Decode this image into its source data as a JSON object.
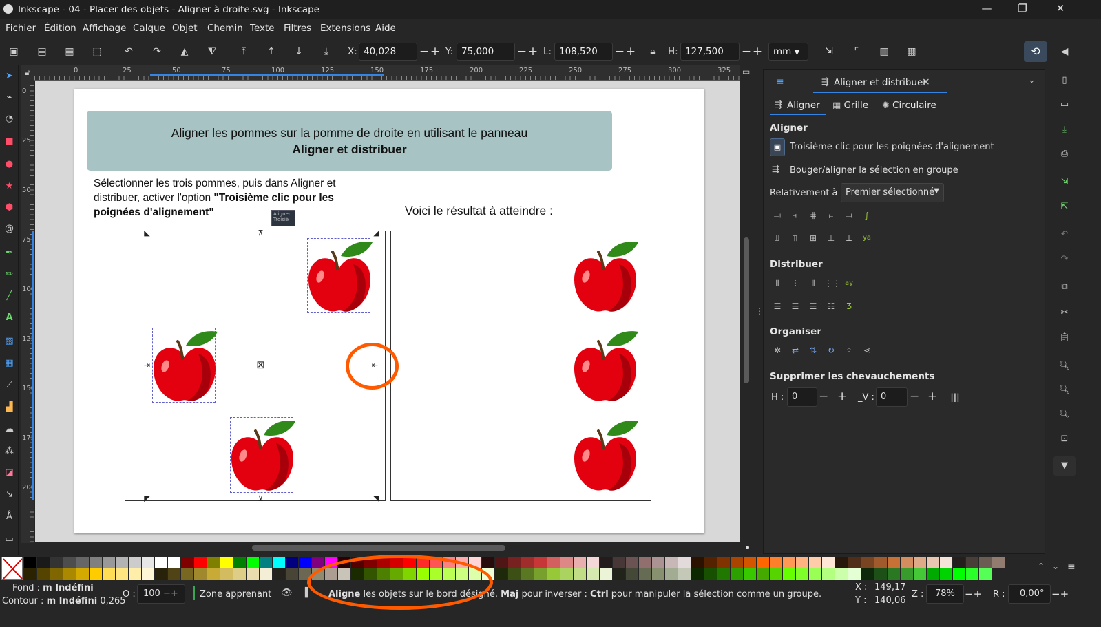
{
  "window": {
    "title": "Inkscape - 04 - Placer des objets - Aligner à droite.svg - Inkscape"
  },
  "menu": [
    "Fichier",
    "Édition",
    "Affichage",
    "Calque",
    "Objet",
    "Chemin",
    "Texte",
    "Filtres",
    "Extensions",
    "Aide"
  ],
  "toolbar": {
    "x_label": "X:",
    "x_value": "40,028",
    "y_label": "Y:",
    "y_value": "75,000",
    "w_label": "L:",
    "w_value": "108,520",
    "h_label": "H:",
    "h_value": "127,500",
    "unit": "mm",
    "minus": "−",
    "plus": "+"
  },
  "ruler": {
    "h_ticks": [
      "0",
      "25",
      "50",
      "75",
      "100",
      "125",
      "150",
      "175",
      "200",
      "225",
      "250",
      "275",
      "300",
      "325"
    ],
    "v_ticks": [
      "0",
      "25",
      "50",
      "75",
      "100",
      "125",
      "150",
      "175",
      "200"
    ]
  },
  "document": {
    "banner_line1": "Aligner les pommes sur la pomme de droite en utilisant le panneau",
    "banner_line2": "Aligner et distribuer",
    "instr_part1": "Sélectionner les trois pommes, puis dans Aligner et distribuer, activer l'option ",
    "instr_bold": "\"Troisième clic pour les poignées d'alignement\"",
    "tooltip_title": "Aligner",
    "tooltip_text": "Troisiè",
    "result_label": "Voici le résultat à atteindre :"
  },
  "panel": {
    "tab_label": "Aligner et distribuer",
    "tab_close": "×",
    "subtabs": [
      "Aligner",
      "Grille",
      "Circulaire"
    ],
    "align_title": "Aligner",
    "opt_third_click": "Troisième clic pour les poignées d'alignement",
    "opt_move_group": "Bouger/aligner la sélection en groupe",
    "relative_label": "Relativement à :",
    "relative_value": "Premier sélectionné",
    "distribute_title": "Distribuer",
    "organize_title": "Organiser",
    "overlap_title": "Supprimer les chevauchements",
    "h_label": "H :",
    "h_value": "0",
    "v_label": "_V :",
    "v_value": "0",
    "minus": "−",
    "plus": "+"
  },
  "status": {
    "fill_label": "Fond :",
    "fill_value": "m Indéfini",
    "stroke_label": "Contour :",
    "stroke_value": "m Indéfini",
    "stroke_width": "0,265",
    "opacity_label": "O :",
    "opacity_value": "100",
    "layer": "Zone apprenant",
    "msg_bold1": "Aligne",
    "msg_1": " les objets sur le bord désigné. ",
    "msg_bold2": "Maj",
    "msg_2": " pour inverser : ",
    "msg_bold3": "Ctrl",
    "msg_3": " pour manipuler la sélection comme un groupe.",
    "x_label": "X :",
    "x_value": "149,17",
    "y_label": "Y :",
    "y_value": "140,06",
    "zoom_label": "Z :",
    "zoom_value": "78%",
    "rot_label": "R :",
    "rot_value": "0,00°"
  },
  "colors": {
    "accent": "#3584e4",
    "banner": "#a8c3c3",
    "annotation": "#ff5a00",
    "apple_red": "#e3000f",
    "leaf_green": "#2f8a1a"
  }
}
